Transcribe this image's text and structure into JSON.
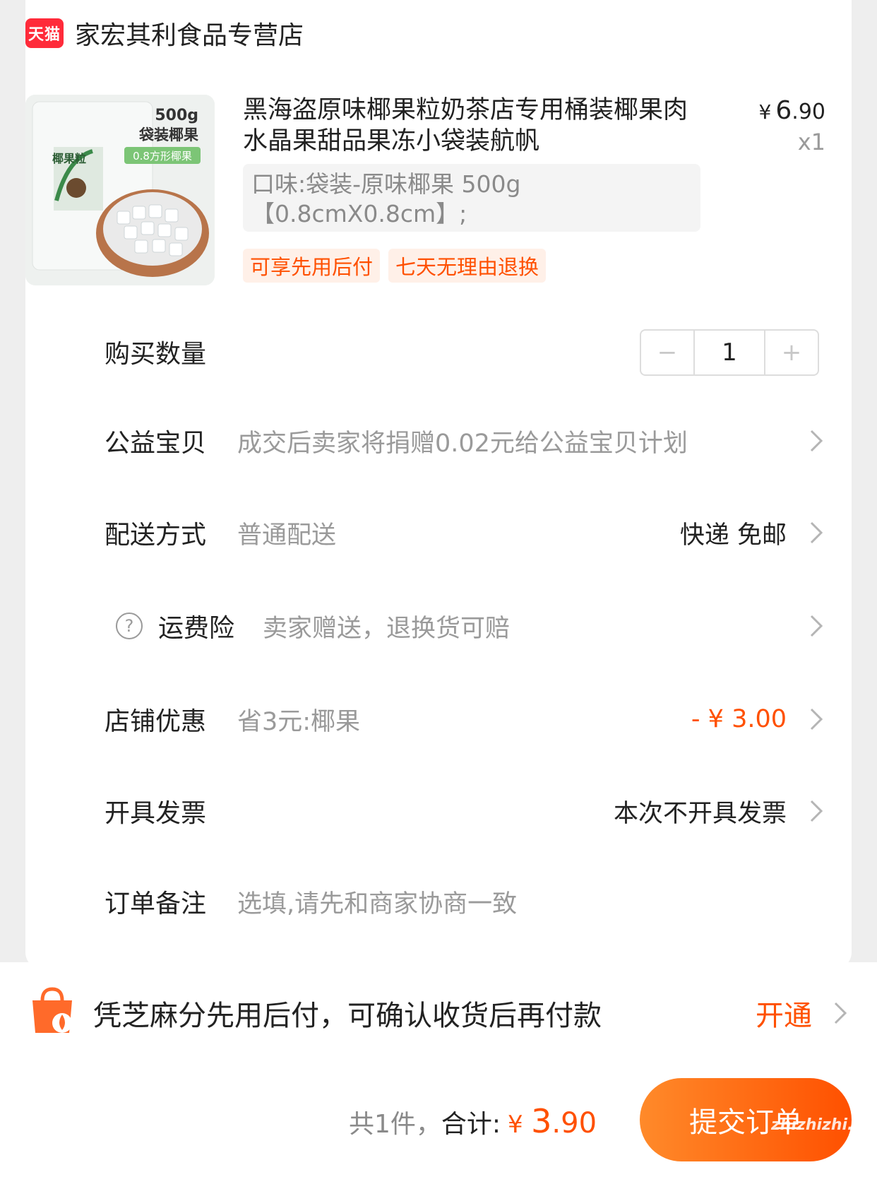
{
  "shop": {
    "badge": "天猫",
    "name": "家宏其利食品专营店"
  },
  "product": {
    "image_text": {
      "weight": "500g",
      "pack": "袋装椰果",
      "size_tag": "0.8方形椰果",
      "brand": "椰果粒"
    },
    "title": "黑海盗原味椰果粒奶茶店专用桶装椰果肉水晶果甜品果冻小袋装航帆",
    "price_yen": "¥",
    "price_int": "6",
    "price_dec": ".90",
    "quantity_label": "x1",
    "sku": "口味:袋装-原味椰果 500g【0.8cmX0.8cm】;",
    "tags": [
      "可享先用后付",
      "七天无理由退换"
    ]
  },
  "rows": {
    "quantity": {
      "label": "购买数量",
      "minus": "−",
      "value": "1",
      "plus": "+"
    },
    "charity": {
      "label": "公益宝贝",
      "desc": "成交后卖家将捐赠0.02元给公益宝贝计划"
    },
    "delivery": {
      "label": "配送方式",
      "desc": "普通配送",
      "value": "快递 免邮"
    },
    "insurance": {
      "label": "运费险",
      "desc": "卖家赠送，退换货可赔"
    },
    "discount": {
      "label": "店铺优惠",
      "desc": "省3元:椰果",
      "value": "- ¥ 3.00"
    },
    "invoice": {
      "label": "开具发票",
      "value": "本次不开具发票"
    },
    "note": {
      "label": "订单备注",
      "placeholder": "选填,请先和商家协商一致"
    }
  },
  "credit": {
    "text": "凭芝麻分先用后付，可确认收货后再付款",
    "action": "开通"
  },
  "footer": {
    "count": "共1件，",
    "total_label": "合计:",
    "yen": "¥",
    "total_int": "3",
    "total_dec": ".90",
    "submit": "提交订单",
    "watermark": "zhizhizhi.com"
  },
  "colors": {
    "accent": "#ff5000",
    "tmall_red": "#ff2b3a",
    "muted": "#9a9a9a"
  }
}
